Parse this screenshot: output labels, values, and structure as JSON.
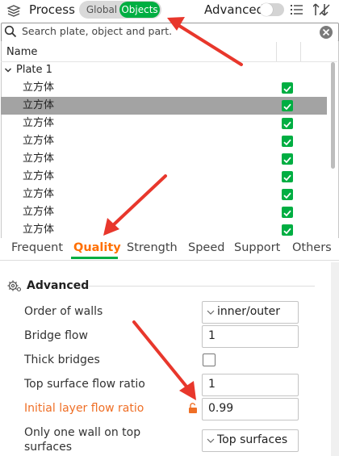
{
  "header": {
    "title": "Process",
    "mode_global": "Global",
    "mode_objects": "Objects",
    "advanced_label": "Advanced",
    "advanced_on": false
  },
  "search": {
    "placeholder": "Search plate, object and part."
  },
  "object_list": {
    "column_name": "Name",
    "plate": "Plate 1",
    "objects": [
      {
        "label": "立方体",
        "checked": true,
        "selected": false
      },
      {
        "label": "立方体",
        "checked": true,
        "selected": true
      },
      {
        "label": "立方体",
        "checked": true,
        "selected": false
      },
      {
        "label": "立方体",
        "checked": true,
        "selected": false
      },
      {
        "label": "立方体",
        "checked": true,
        "selected": false
      },
      {
        "label": "立方体",
        "checked": true,
        "selected": false
      },
      {
        "label": "立方体",
        "checked": true,
        "selected": false
      },
      {
        "label": "立方体",
        "checked": true,
        "selected": false
      },
      {
        "label": "立方体",
        "checked": true,
        "selected": false
      }
    ]
  },
  "tabs": {
    "items": [
      "Frequent",
      "Quality",
      "Strength",
      "Speed",
      "Support",
      "Others"
    ],
    "active": "Quality"
  },
  "settings": {
    "section_title": "Advanced",
    "order_of_walls": {
      "label": "Order of walls",
      "value": "inner/outer"
    },
    "bridge_flow": {
      "label": "Bridge flow",
      "value": "1"
    },
    "thick_bridges": {
      "label": "Thick bridges",
      "checked": false
    },
    "top_surface_flow_ratio": {
      "label": "Top surface flow ratio",
      "value": "1"
    },
    "initial_layer_flow_ratio": {
      "label": "Initial layer flow ratio",
      "value": "0.99",
      "modified": true
    },
    "only_one_wall_top": {
      "label_line1": "Only one wall on top",
      "label_line2": "surfaces",
      "value": "Top surfaces"
    }
  },
  "colors": {
    "accent_green": "#00ae42",
    "modified_orange": "#ef6f26",
    "active_tab_orange": "#ff6f00",
    "annotation_red": "#e8372c"
  }
}
